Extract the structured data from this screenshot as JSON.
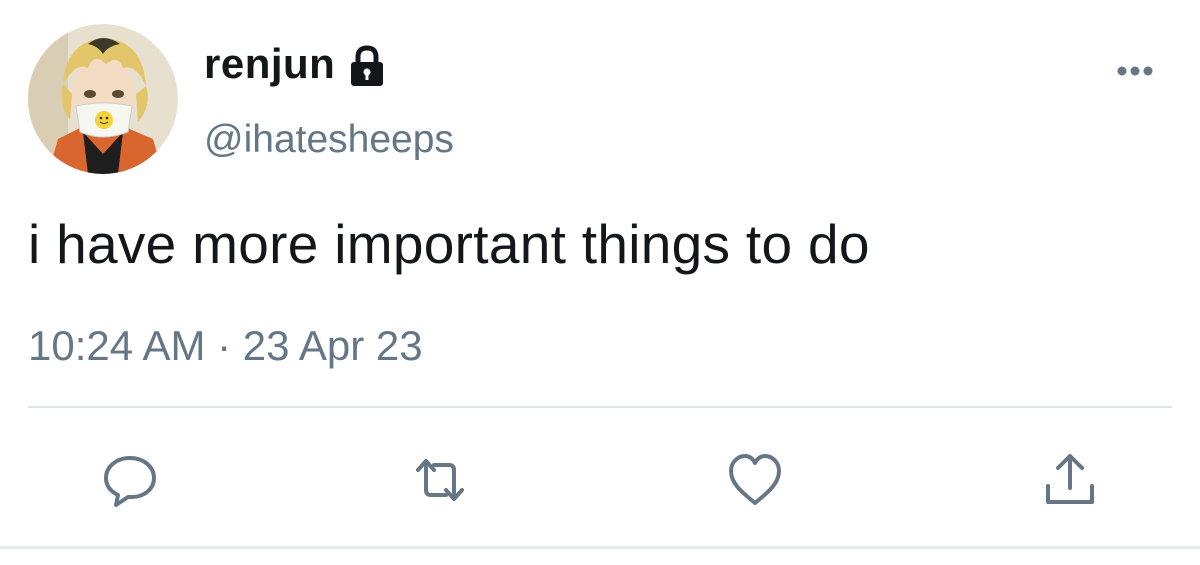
{
  "tweet": {
    "author": {
      "display_name": "renjun",
      "handle": "@ihatesheeps",
      "protected": true,
      "avatar_icon": "anime-character-avatar"
    },
    "text": "i have more important things to do",
    "timestamp": "10:24 AM · 23 Apr 23"
  },
  "actions": [
    {
      "name": "reply",
      "icon": "reply-icon"
    },
    {
      "name": "retweet",
      "icon": "retweet-icon"
    },
    {
      "name": "like",
      "icon": "heart-icon"
    },
    {
      "name": "share",
      "icon": "share-icon"
    }
  ],
  "colors": {
    "text_primary": "#14171a",
    "text_secondary": "#657786",
    "icon_color": "#657786",
    "divider": "#e1e8ed"
  }
}
